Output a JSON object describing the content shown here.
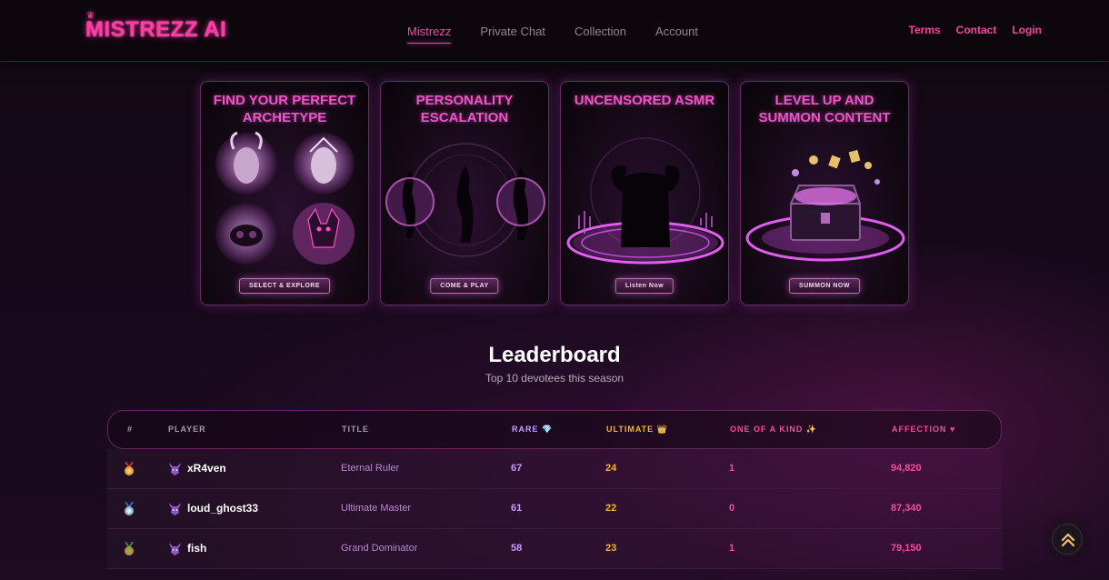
{
  "brand": {
    "name": "MISTREZZ AI",
    "crown": "♛"
  },
  "nav": {
    "tabs": [
      "Mistrezz",
      "Private Chat",
      "Collection",
      "Account"
    ],
    "active_tab": 0,
    "links": [
      "Terms",
      "Contact",
      "Login"
    ]
  },
  "cards": [
    {
      "title": "FIND YOUR PERFECT ARCHETYPE",
      "button": "SELECT & EXPLORE"
    },
    {
      "title": "PERSONALITY ESCALATION",
      "button": "COME & PLAY"
    },
    {
      "title": "UNCENSORED ASMR",
      "button": "Listen Now"
    },
    {
      "title": "LEVEL UP AND SUMMON CONTENT",
      "button": "SUMMON NOW"
    }
  ],
  "leaderboard": {
    "title": "Leaderboard",
    "subtitle": "Top 10 devotees this season",
    "headers": {
      "rank": "#",
      "player": "PLAYER",
      "title": "TITLE",
      "rare": "RARE 💎",
      "ultimate": "ULTIMATE 👑",
      "one_of_a_kind": "ONE OF A KIND ✨",
      "affection": "AFFECTION ♥"
    },
    "rows": [
      {
        "medal": "gold",
        "player": "xR4ven",
        "title": "Eternal Ruler",
        "rare": "67",
        "ultimate": "24",
        "one_of_a_kind": "1",
        "affection": "94,820"
      },
      {
        "medal": "silver",
        "player": "loud_ghost33",
        "title": "Ultimate Master",
        "rare": "61",
        "ultimate": "22",
        "one_of_a_kind": "0",
        "affection": "87,340"
      },
      {
        "medal": "bronze",
        "player": "fish",
        "title": "Grand Dominator",
        "rare": "58",
        "ultimate": "23",
        "one_of_a_kind": "1",
        "affection": "79,150"
      }
    ]
  },
  "colors": {
    "accent": "#f04aa8",
    "rare": "#c79bff",
    "ultimate": "#f2b43a",
    "affection": "#f24c9e",
    "medal_gold": "#e8a43a",
    "medal_silver": "#8fb9d6",
    "medal_bronze": "#6fbf5a"
  },
  "icons": {
    "scroll_top": "double-chevron-up-icon",
    "avatar": "demon-avatar-icon"
  }
}
